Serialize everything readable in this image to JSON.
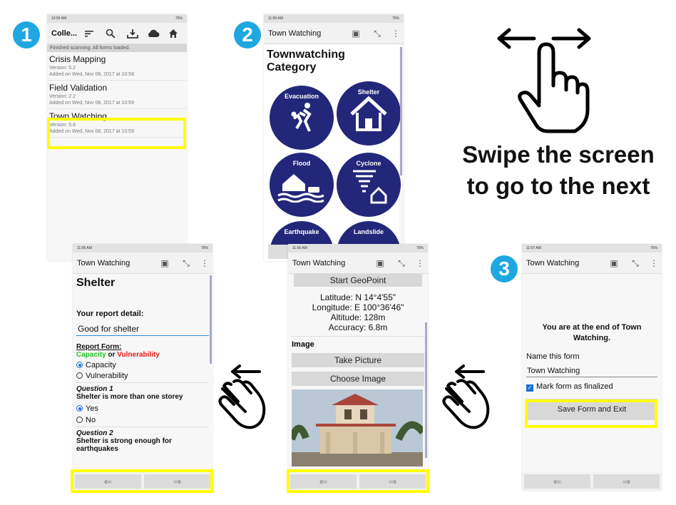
{
  "badges": [
    "1",
    "2",
    "3"
  ],
  "headline": {
    "line1": "Swipe the screen",
    "line2": "to go to the next"
  },
  "screen1": {
    "status_time": "10:59 AM",
    "battery": "76%",
    "title": "Colle...",
    "icons": [
      "sort-icon",
      "search-icon",
      "download-icon",
      "cloud-icon",
      "home-icon"
    ],
    "banner": "Finished scanning. All forms loaded.",
    "forms": [
      {
        "name": "Crisis Mapping",
        "version": "Version: 5.2",
        "added": "Added on Wed, Nov 08, 2017 at 10:58"
      },
      {
        "name": "Field Validation",
        "version": "Version: 2.2",
        "added": "Added on Wed, Nov 08, 2017 at 10:59"
      },
      {
        "name": "Town Watching",
        "version": "Version: 5.6",
        "added": "Added on Wed, Nov 08, 2017 at 10:59"
      }
    ]
  },
  "screen2": {
    "status_time": "11:00 AM",
    "battery": "76%",
    "title": "Town Watching",
    "heading": "Townwatching Category",
    "categories": [
      "Evacuation",
      "Shelter",
      "Flood",
      "Cyclone",
      "Earthquake",
      "Landslide"
    ]
  },
  "screen3": {
    "status_time": "11:05 AM",
    "battery": "76%",
    "title": "Town Watching",
    "heading": "Shelter",
    "report_detail_label": "Your report detail:",
    "report_detail_value": "Good for shelter",
    "report_form_label": "Report Form:",
    "capacity_word": "Capacity",
    "or_word": " or ",
    "vulnerability_word": "Vulnerability",
    "options1": [
      "Capacity",
      "Vulnerability"
    ],
    "q1_label": "Question 1",
    "q1_text": "Shelter is more than one storey",
    "options2": [
      "Yes",
      "No"
    ],
    "q2_label": "Question 2",
    "q2_text": "Shelter is strong enough for earthquakes"
  },
  "screen4": {
    "status_time": "11:06 AM",
    "battery": "76%",
    "title": "Town Watching",
    "geopoint_button": "Start GeoPoint",
    "latitude": "Latitude: N 14°4'55\"",
    "longitude": "Longitude: E 100°36'46\"",
    "altitude": "Altitude: 128m",
    "accuracy": "Accuracy: 6.8m",
    "image_label": "Image",
    "take_picture": "Take Picture",
    "choose_image": "Choose Image"
  },
  "screen5": {
    "status_time": "11:07 AM",
    "battery": "76%",
    "title": "Town Watching",
    "end_message": "You are at the end of Town Watching.",
    "name_label": "Name this form",
    "name_value": "Town Watching",
    "finalize_label": "Mark form as finalized",
    "save_button": "Save Form and Exit"
  },
  "nav": {
    "prev": "⇐",
    "next": "⇒"
  },
  "colors": {
    "accent": "#1ea7e1",
    "highlight": "#ffff00",
    "category": "#23277a",
    "capacity": "#22c422",
    "vulnerability": "#e01b1b"
  }
}
